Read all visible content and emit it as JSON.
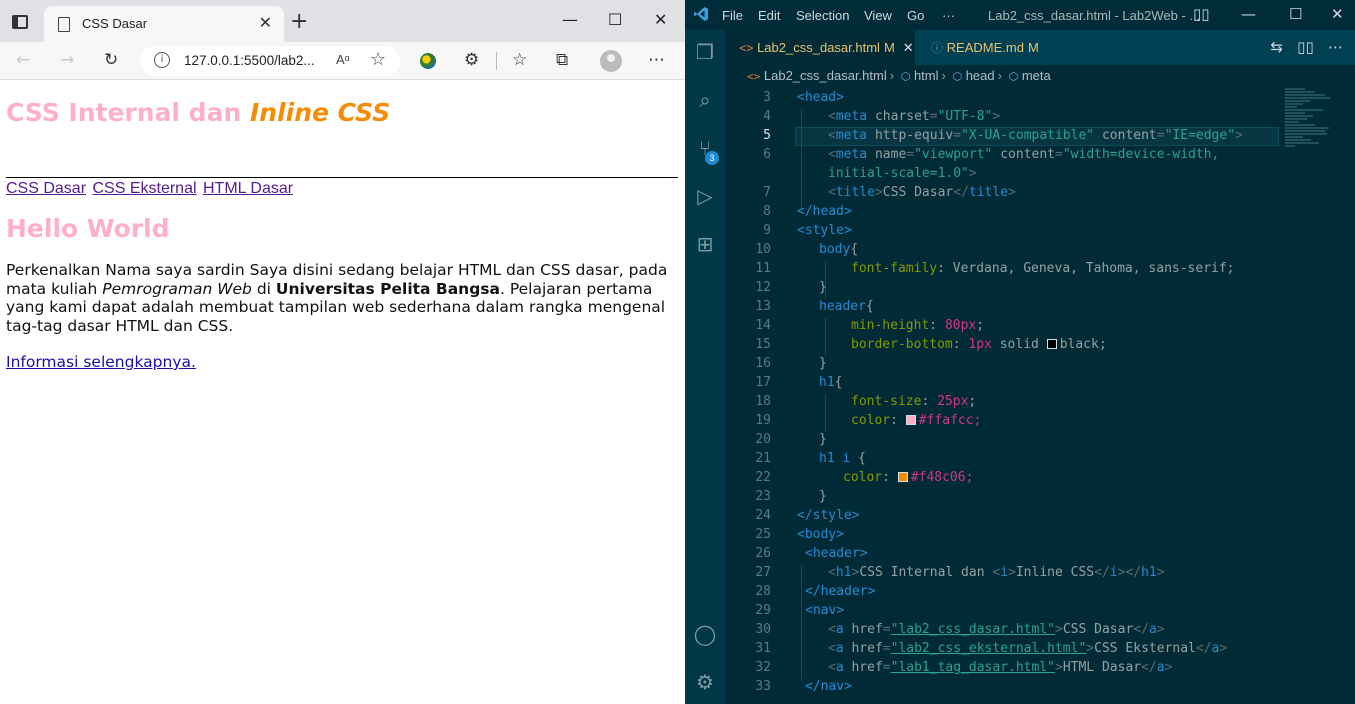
{
  "browser": {
    "tab_title": "CSS Dasar",
    "url": "127.0.0.1:5500/lab2...",
    "read_aloud": "Aᵅ",
    "page": {
      "header_title_plain": "CSS Internal dan ",
      "header_title_italic": "Inline CSS",
      "nav_links": [
        "CSS Dasar",
        "CSS Eksternal",
        "HTML Dasar"
      ],
      "heading": "Hello World",
      "paragraph": {
        "part1": "Perkenalkan Nama saya sardin Saya disini sedang belajar HTML dan CSS dasar, pada mata kuliah ",
        "italic": "Pemrograman Web",
        "part2": " di ",
        "bold": "Universitas Pelita Bangsa",
        "part3": ". Pelajaran pertama yang kami dapat adalah membuat tampilan web sederhana dalam rangka mengenal tag-tag dasar HTML dan CSS."
      },
      "more_link": "Informasi selengkapnya."
    }
  },
  "vscode": {
    "menu": [
      "File",
      "Edit",
      "Selection",
      "View",
      "Go",
      "···"
    ],
    "window_title": "Lab2_css_dasar.html - Lab2Web - ...",
    "tabs": [
      {
        "name": "Lab2_css_dasar.html",
        "modified": "M",
        "active": true
      },
      {
        "name": "README.md",
        "modified": "M",
        "active": false
      }
    ],
    "breadcrumbs": [
      "Lab2_css_dasar.html",
      "html",
      "head",
      "meta"
    ],
    "scm_badge": "3",
    "colors": {
      "h1_color": "#ffafcc",
      "h1_i_color": "#f48c06",
      "border_color": "black"
    },
    "code": {
      "l3": "<head>",
      "l4": {
        "tag": "meta",
        "attr": "charset",
        "val": "\"UTF-8\""
      },
      "l5": {
        "tag": "meta",
        "attr1": "http-equiv",
        "val1": "\"X-UA-compatible\"",
        "attr2": "content",
        "val2": "\"IE=edge\""
      },
      "l6a": {
        "tag": "meta",
        "attr1": "name",
        "val1": "\"viewport\"",
        "attr2": "content",
        "val2": "\"width=device-width,"
      },
      "l6b": "initial-scale=1.0\"",
      "l7": {
        "tag": "title",
        "text": "CSS Dasar"
      },
      "l8": "</head>",
      "l9": "<style>",
      "l10": "body",
      "l11": {
        "prop": "font-family",
        "val": "Verdana, Geneva, Tahoma, sans-serif;"
      },
      "l13": "header",
      "l14": {
        "prop": "min-height",
        "num": "80px"
      },
      "l15": {
        "prop": "border-bottom",
        "num": "1px",
        "rest": "solid ",
        "color": "black;"
      },
      "l17": "h1",
      "l18": {
        "prop": "font-size",
        "num": "25px"
      },
      "l19": {
        "prop": "color",
        "color": "#ffafcc;"
      },
      "l21": "h1 i",
      "l22": {
        "prop": "color",
        "color": "#f48c06;"
      },
      "l24": "</style>",
      "l25": "<body>",
      "l26": "<header>",
      "l27": {
        "h1": "CSS Internal dan ",
        "i": "Inline CSS"
      },
      "l28": "</header>",
      "l29": "<nav>",
      "l30": {
        "href": "\"lab2_css_dasar.html\"",
        "text": "CSS Dasar"
      },
      "l31": {
        "href": "\"lab2_css_eksternal.html\"",
        "text": "CSS Eksternal"
      },
      "l32": {
        "href": "\"lab1_tag_dasar.html\"",
        "text": "HTML Dasar"
      },
      "l33": "</nav>"
    }
  }
}
